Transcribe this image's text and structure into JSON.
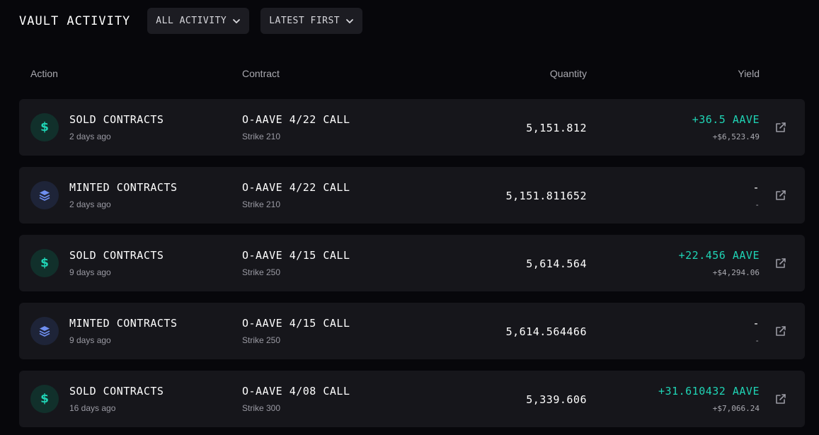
{
  "header": {
    "title": "VAULT ACTIVITY",
    "filter_dropdown": {
      "label": "ALL ACTIVITY",
      "icon": "chevron-down-icon"
    },
    "sort_dropdown": {
      "label": "LATEST FIRST",
      "icon": "chevron-down-icon"
    }
  },
  "columns": {
    "action": "Action",
    "contract": "Contract",
    "quantity": "Quantity",
    "yield": "Yield"
  },
  "colors": {
    "background": "#07070b",
    "row_background": "#16161b",
    "accent_green": "#1fd4b5",
    "minted_icon_blue": "#6f8ff0",
    "muted_text": "#9a9aa3"
  },
  "rows": [
    {
      "type": "sold",
      "icon": "dollar-icon",
      "action": "SOLD CONTRACTS",
      "time": "2 days ago",
      "contract": "O-AAVE 4/22 CALL",
      "strike": "Strike 210",
      "quantity": "5,151.812",
      "yield": "+36.5 AAVE",
      "yield_usd": "+$6,523.49",
      "link_icon": "external-link-icon"
    },
    {
      "type": "minted",
      "icon": "layers-icon",
      "action": "MINTED CONTRACTS",
      "time": "2 days ago",
      "contract": "O-AAVE 4/22 CALL",
      "strike": "Strike 210",
      "quantity": "5,151.811652",
      "yield": "-",
      "yield_usd": "-",
      "link_icon": "external-link-icon"
    },
    {
      "type": "sold",
      "icon": "dollar-icon",
      "action": "SOLD CONTRACTS",
      "time": "9 days ago",
      "contract": "O-AAVE 4/15 CALL",
      "strike": "Strike 250",
      "quantity": "5,614.564",
      "yield": "+22.456 AAVE",
      "yield_usd": "+$4,294.06",
      "link_icon": "external-link-icon"
    },
    {
      "type": "minted",
      "icon": "layers-icon",
      "action": "MINTED CONTRACTS",
      "time": "9 days ago",
      "contract": "O-AAVE 4/15 CALL",
      "strike": "Strike 250",
      "quantity": "5,614.564466",
      "yield": "-",
      "yield_usd": "-",
      "link_icon": "external-link-icon"
    },
    {
      "type": "sold",
      "icon": "dollar-icon",
      "action": "SOLD CONTRACTS",
      "time": "16 days ago",
      "contract": "O-AAVE 4/08 CALL",
      "strike": "Strike 300",
      "quantity": "5,339.606",
      "yield": "+31.610432 AAVE",
      "yield_usd": "+$7,066.24",
      "link_icon": "external-link-icon"
    }
  ]
}
